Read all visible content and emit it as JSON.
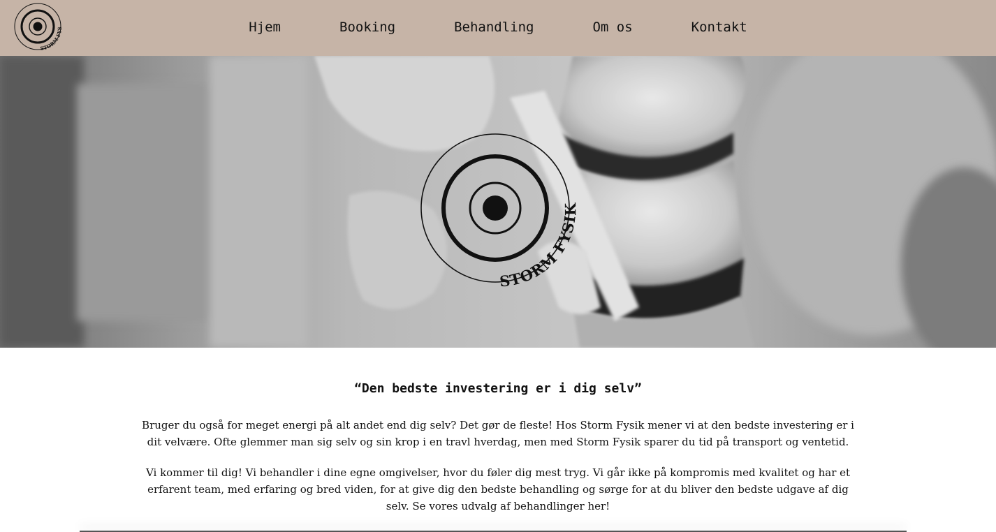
{
  "brand": {
    "name": "STORM FYSIK"
  },
  "nav": {
    "items": [
      {
        "label": "Hjem"
      },
      {
        "label": "Booking"
      },
      {
        "label": "Behandling"
      },
      {
        "label": "Om os"
      },
      {
        "label": "Kontakt"
      }
    ]
  },
  "hero": {
    "logo_text": "STORM FYSIK"
  },
  "content": {
    "tagline": "“Den bedste investering er i dig selv”",
    "paragraph_1": "Bruger du også for meget energi på alt andet end dig selv? Det gør de fleste! Hos Storm Fysik mener vi at den bedste investering er i dit velvære. Ofte glemmer man sig selv og sin krop i en travl hverdag, men med Storm Fysik sparer du tid på transport og ventetid.",
    "paragraph_2": "Vi kommer til dig! Vi behandler i dine egne omgivelser, hvor du føler dig mest tryg. Vi går ikke på kompromis med kvalitet og har et erfarent team, med erfaring og bred viden, for at give dig den bedste behandling og sørge for at du bliver den bedste udgave af dig selv. Se vores udvalg af behandlinger her!"
  },
  "colors": {
    "nav_background": "#c6b4a7",
    "text": "#111111",
    "page_background": "#ffffff"
  }
}
